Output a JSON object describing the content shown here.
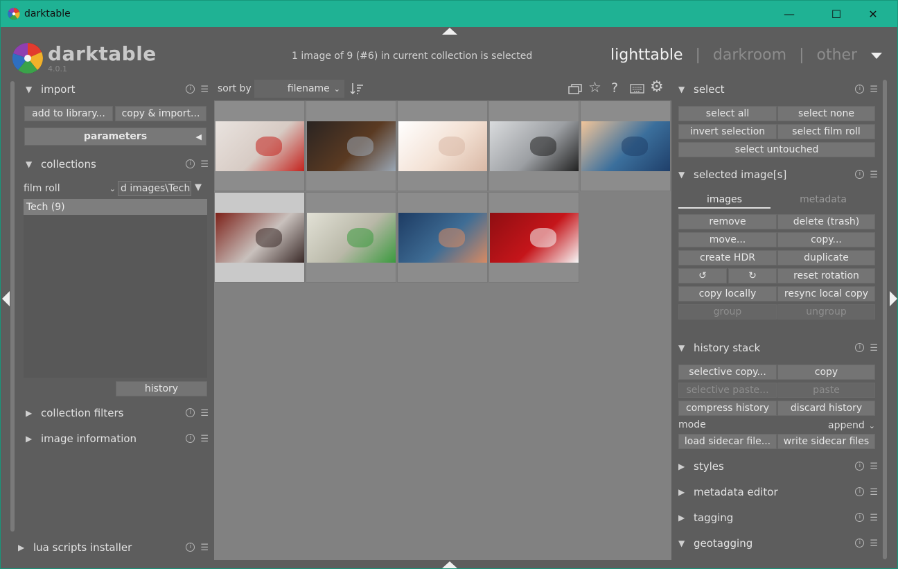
{
  "window": {
    "title": "darktable",
    "controls": {
      "minimize": "—",
      "maximize": "☐",
      "close": "✕"
    }
  },
  "header": {
    "brand": "darktable",
    "version": "4.0.1",
    "status": "1 image of 9 (#6) in current collection is selected",
    "views": {
      "lighttable": "lighttable",
      "darkroom": "darkroom",
      "other": "other",
      "sep": "|"
    }
  },
  "left": {
    "import": {
      "title": "import",
      "add_btn": "add to library...",
      "copy_btn": "copy & import...",
      "params_btn": "parameters"
    },
    "collections": {
      "title": "collections",
      "rule": "film roll",
      "value": "d images\\Tech",
      "item": "Tech (9)",
      "history_btn": "history"
    },
    "collection_filters": "collection filters",
    "image_information": "image information",
    "lua": "lua scripts installer"
  },
  "toolbar": {
    "sort_label": "sort by",
    "sort_value": "filename"
  },
  "right": {
    "select": {
      "title": "select",
      "buttons": [
        "select all",
        "select none",
        "invert selection",
        "select film roll",
        "select untouched"
      ]
    },
    "selected_images": {
      "title": "selected image[s]",
      "tab_images": "images",
      "tab_metadata": "metadata",
      "remove": "remove",
      "delete": "delete (trash)",
      "move": "move...",
      "copy": "copy...",
      "hdr": "create HDR",
      "duplicate": "duplicate",
      "rot_left": "↺",
      "rot_right": "↻",
      "reset_rotation": "reset rotation",
      "copy_locally": "copy locally",
      "resync": "resync local copy",
      "group": "group",
      "ungroup": "ungroup"
    },
    "history_stack": {
      "title": "history stack",
      "selective_copy": "selective copy...",
      "copy": "copy",
      "selective_paste": "selective paste...",
      "paste": "paste",
      "compress": "compress history",
      "discard": "discard history",
      "mode_label": "mode",
      "mode_value": "append",
      "load": "load sidecar file...",
      "write": "write sidecar files"
    },
    "styles": "styles",
    "metadata_editor": "metadata editor",
    "tagging": "tagging",
    "geotagging": "geotagging"
  },
  "thumbnails": [
    {
      "name": "headphones",
      "colors": [
        "#e9e3df",
        "#d7cbc4",
        "#c4231e"
      ]
    },
    {
      "name": "desk-imac",
      "colors": [
        "#2a2422",
        "#5a3a22",
        "#9aa7b5"
      ]
    },
    {
      "name": "iphone",
      "colors": [
        "#ffffff",
        "#f3e1d4",
        "#d9b8a5"
      ]
    },
    {
      "name": "linux-cube",
      "colors": [
        "#d9dbdd",
        "#9c9fa3",
        "#222222"
      ]
    },
    {
      "name": "wave",
      "colors": [
        "#f1c59a",
        "#3b6f9c",
        "#1f3f6a"
      ]
    },
    {
      "name": "hard-drive",
      "colors": [
        "#7c2119",
        "#c9c1bd",
        "#3a2a28"
      ]
    },
    {
      "name": "chain-fence",
      "colors": [
        "#e2e1d6",
        "#b9b8a8",
        "#3b9a3e"
      ]
    },
    {
      "name": "ubuntu-bokeh",
      "colors": [
        "#1d3b63",
        "#3f6d95",
        "#d88a63"
      ]
    },
    {
      "name": "youtube",
      "colors": [
        "#8e0e12",
        "#c5151a",
        "#f6f6f6"
      ]
    }
  ]
}
